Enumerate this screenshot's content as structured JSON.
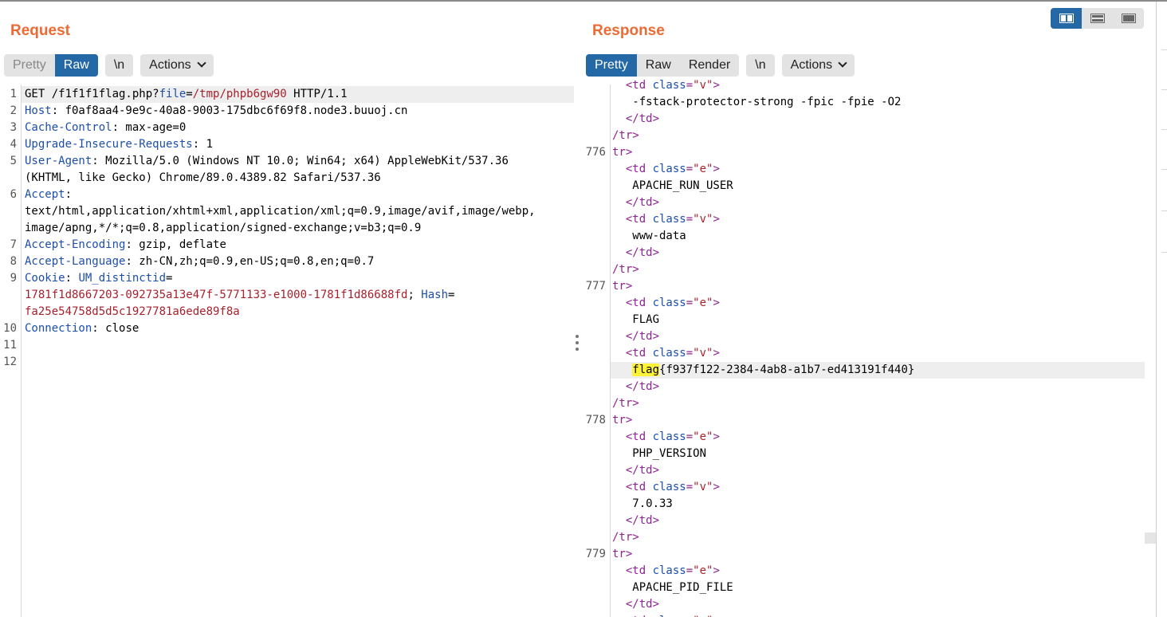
{
  "request": {
    "title": "Request",
    "tabs": [
      "Pretty",
      "Raw"
    ],
    "newline_label": "\\n",
    "actions_label": "Actions",
    "lines": [
      {
        "n": "1",
        "parts": [
          [
            "",
            "GET /f1f1f1flag.php?"
          ],
          [
            "blu",
            "file"
          ],
          [
            "",
            "="
          ],
          [
            "red",
            "/tmp/phpb6gw90"
          ],
          [
            "",
            " HTTP/1.1"
          ]
        ]
      },
      {
        "n": "2",
        "parts": [
          [
            "hdr",
            "Host"
          ],
          [
            "",
            ": f0af8aa4-9e9c-40a8-9003-175dbc6f69f8.node3.buuoj.cn"
          ]
        ]
      },
      {
        "n": "3",
        "parts": [
          [
            "hdr",
            "Cache-Control"
          ],
          [
            "",
            ": max-age=0"
          ]
        ]
      },
      {
        "n": "4",
        "parts": [
          [
            "hdr",
            "Upgrade-Insecure-Requests"
          ],
          [
            "",
            ": 1"
          ]
        ]
      },
      {
        "n": "5",
        "parts": [
          [
            "hdr",
            "User-Agent"
          ],
          [
            "",
            ": Mozilla/5.0 (Windows NT 10.0; Win64; x64) AppleWebKit/537.36"
          ]
        ]
      },
      {
        "n": "",
        "parts": [
          [
            "",
            "(KHTML, like Gecko) Chrome/89.0.4389.82 Safari/537.36"
          ]
        ]
      },
      {
        "n": "6",
        "parts": [
          [
            "hdr",
            "Accept"
          ],
          [
            "",
            ":"
          ]
        ]
      },
      {
        "n": "",
        "parts": [
          [
            "",
            "text/html,application/xhtml+xml,application/xml;q=0.9,image/avif,image/webp,"
          ]
        ]
      },
      {
        "n": "",
        "parts": [
          [
            "",
            "image/apng,*/*;q=0.8,application/signed-exchange;v=b3;q=0.9"
          ]
        ]
      },
      {
        "n": "7",
        "parts": [
          [
            "hdr",
            "Accept-Encoding"
          ],
          [
            "",
            ": gzip, deflate"
          ]
        ]
      },
      {
        "n": "8",
        "parts": [
          [
            "hdr",
            "Accept-Language"
          ],
          [
            "",
            ": zh-CN,zh;q=0.9,en-US;q=0.8,en;q=0.7"
          ]
        ]
      },
      {
        "n": "9",
        "parts": [
          [
            "hdr",
            "Cookie"
          ],
          [
            "",
            ": "
          ],
          [
            "blu",
            "UM_distinctid"
          ],
          [
            "",
            "="
          ]
        ]
      },
      {
        "n": "",
        "parts": [
          [
            "red",
            "1781f1d8667203-092735a13e47f-5771133-e1000-1781f1d86688fd"
          ],
          [
            "",
            "; "
          ],
          [
            "blu",
            "Hash"
          ],
          [
            "",
            "="
          ]
        ]
      },
      {
        "n": "",
        "parts": [
          [
            "red",
            "fa25e54758d5d5c1927781a6ede89f8a"
          ]
        ]
      },
      {
        "n": "10",
        "parts": [
          [
            "hdr",
            "Connection"
          ],
          [
            "",
            ": close"
          ]
        ]
      },
      {
        "n": "11",
        "parts": []
      },
      {
        "n": "12",
        "parts": []
      }
    ]
  },
  "response": {
    "title": "Response",
    "tabs": [
      "Pretty",
      "Raw",
      "Render"
    ],
    "newline_label": "\\n",
    "actions_label": "Actions",
    "lines": [
      {
        "n": "",
        "parts": [
          [
            "",
            "  "
          ],
          [
            "tag",
            "<td "
          ],
          [
            "attr",
            "class"
          ],
          [
            "tag",
            "="
          ],
          [
            "str",
            "\"v\""
          ],
          [
            "tag",
            ">"
          ]
        ]
      },
      {
        "n": "",
        "parts": [
          [
            "",
            "   -fstack-protector-strong -fpic -fpie -O2"
          ]
        ]
      },
      {
        "n": "",
        "parts": [
          [
            "",
            "  "
          ],
          [
            "tag",
            "</td>"
          ]
        ]
      },
      {
        "n": "",
        "parts": [
          [
            "tag",
            "/tr>"
          ]
        ]
      },
      {
        "n": "776",
        "parts": [
          [
            "tag",
            "tr>"
          ]
        ]
      },
      {
        "n": "",
        "parts": [
          [
            "",
            "  "
          ],
          [
            "tag",
            "<td "
          ],
          [
            "attr",
            "class"
          ],
          [
            "tag",
            "="
          ],
          [
            "str",
            "\"e\""
          ],
          [
            "tag",
            ">"
          ]
        ]
      },
      {
        "n": "",
        "parts": [
          [
            "",
            "   APACHE_RUN_USER"
          ]
        ]
      },
      {
        "n": "",
        "parts": [
          [
            "",
            "  "
          ],
          [
            "tag",
            "</td>"
          ]
        ]
      },
      {
        "n": "",
        "parts": [
          [
            "",
            "  "
          ],
          [
            "tag",
            "<td "
          ],
          [
            "attr",
            "class"
          ],
          [
            "tag",
            "="
          ],
          [
            "str",
            "\"v\""
          ],
          [
            "tag",
            ">"
          ]
        ]
      },
      {
        "n": "",
        "parts": [
          [
            "",
            "   www-data"
          ]
        ]
      },
      {
        "n": "",
        "parts": [
          [
            "",
            "  "
          ],
          [
            "tag",
            "</td>"
          ]
        ]
      },
      {
        "n": "",
        "parts": [
          [
            "tag",
            "/tr>"
          ]
        ]
      },
      {
        "n": "777",
        "parts": [
          [
            "tag",
            "tr>"
          ]
        ]
      },
      {
        "n": "",
        "parts": [
          [
            "",
            "  "
          ],
          [
            "tag",
            "<td "
          ],
          [
            "attr",
            "class"
          ],
          [
            "tag",
            "="
          ],
          [
            "str",
            "\"e\""
          ],
          [
            "tag",
            ">"
          ]
        ]
      },
      {
        "n": "",
        "parts": [
          [
            "",
            "   FLAG"
          ]
        ]
      },
      {
        "n": "",
        "parts": [
          [
            "",
            "  "
          ],
          [
            "tag",
            "</td>"
          ]
        ]
      },
      {
        "n": "",
        "parts": [
          [
            "",
            "  "
          ],
          [
            "tag",
            "<td "
          ],
          [
            "attr",
            "class"
          ],
          [
            "tag",
            "="
          ],
          [
            "str",
            "\"v\""
          ],
          [
            "tag",
            ">"
          ]
        ]
      },
      {
        "n": "",
        "parts": [
          [
            "",
            "   "
          ],
          [
            "hl",
            "flag"
          ],
          [
            "",
            "{f937f122-2384-4ab8-a1b7-ed413191f440}"
          ]
        ],
        "current": true
      },
      {
        "n": "",
        "parts": [
          [
            "",
            "  "
          ],
          [
            "tag",
            "</td>"
          ]
        ]
      },
      {
        "n": "",
        "parts": [
          [
            "tag",
            "/tr>"
          ]
        ]
      },
      {
        "n": "778",
        "parts": [
          [
            "tag",
            "tr>"
          ]
        ]
      },
      {
        "n": "",
        "parts": [
          [
            "",
            "  "
          ],
          [
            "tag",
            "<td "
          ],
          [
            "attr",
            "class"
          ],
          [
            "tag",
            "="
          ],
          [
            "str",
            "\"e\""
          ],
          [
            "tag",
            ">"
          ]
        ]
      },
      {
        "n": "",
        "parts": [
          [
            "",
            "   PHP_VERSION"
          ]
        ]
      },
      {
        "n": "",
        "parts": [
          [
            "",
            "  "
          ],
          [
            "tag",
            "</td>"
          ]
        ]
      },
      {
        "n": "",
        "parts": [
          [
            "",
            "  "
          ],
          [
            "tag",
            "<td "
          ],
          [
            "attr",
            "class"
          ],
          [
            "tag",
            "="
          ],
          [
            "str",
            "\"v\""
          ],
          [
            "tag",
            ">"
          ]
        ]
      },
      {
        "n": "",
        "parts": [
          [
            "",
            "   7.0.33"
          ]
        ]
      },
      {
        "n": "",
        "parts": [
          [
            "",
            "  "
          ],
          [
            "tag",
            "</td>"
          ]
        ]
      },
      {
        "n": "",
        "parts": [
          [
            "tag",
            "/tr>"
          ]
        ]
      },
      {
        "n": "779",
        "parts": [
          [
            "tag",
            "tr>"
          ]
        ]
      },
      {
        "n": "",
        "parts": [
          [
            "",
            "  "
          ],
          [
            "tag",
            "<td "
          ],
          [
            "attr",
            "class"
          ],
          [
            "tag",
            "="
          ],
          [
            "str",
            "\"e\""
          ],
          [
            "tag",
            ">"
          ]
        ]
      },
      {
        "n": "",
        "parts": [
          [
            "",
            "   APACHE_PID_FILE"
          ]
        ]
      },
      {
        "n": "",
        "parts": [
          [
            "",
            "  "
          ],
          [
            "tag",
            "</td>"
          ]
        ]
      },
      {
        "n": "",
        "parts": [
          [
            "",
            "  "
          ],
          [
            "tag",
            "<td "
          ],
          [
            "attr",
            "class"
          ],
          [
            "tag",
            "="
          ],
          [
            "str",
            "\"v\""
          ],
          [
            "tag",
            ">"
          ]
        ]
      }
    ]
  },
  "colors": {
    "accent": "#ec6a33",
    "selected_tab": "#2469a6",
    "header_name": "#1d4faa",
    "value_red": "#a8202c",
    "tag_purple": "#8e2392",
    "highlight": "#fff33a"
  },
  "view_buttons": [
    "split-horizontal-icon",
    "split-vertical-icon",
    "single-pane-icon"
  ]
}
